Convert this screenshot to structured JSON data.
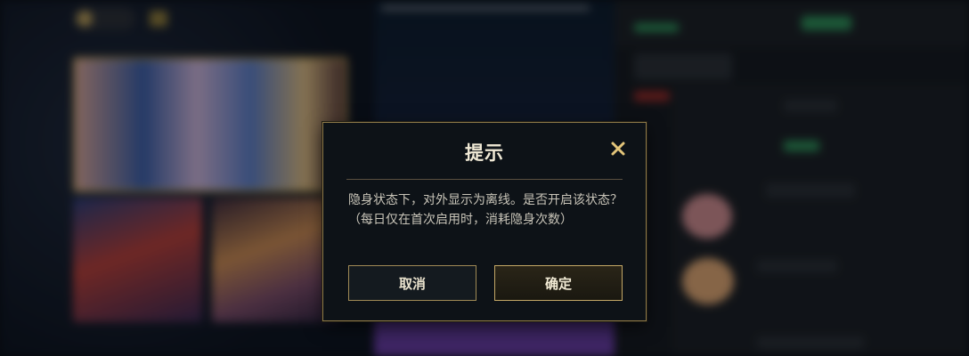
{
  "dialog": {
    "title": "提示",
    "message": "隐身状态下，对外显示为离线。是否开启该状态？",
    "note": "（每日仅在首次启用时，消耗隐身次数）",
    "cancel_label": "取消",
    "confirm_label": "确定",
    "close_icon": "close-icon"
  },
  "colors": {
    "accent_gold": "#c4a866",
    "dialog_bg": "#0d1217",
    "title_text": "#f1ead6"
  }
}
